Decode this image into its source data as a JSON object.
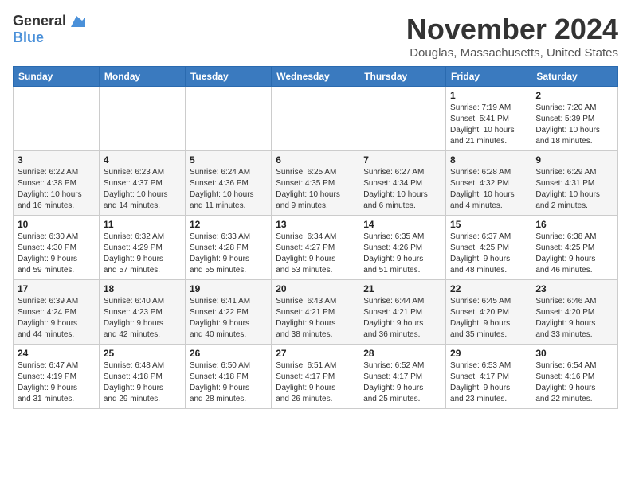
{
  "logo": {
    "line1": "General",
    "line2": "Blue"
  },
  "header": {
    "month": "November 2024",
    "location": "Douglas, Massachusetts, United States"
  },
  "weekdays": [
    "Sunday",
    "Monday",
    "Tuesday",
    "Wednesday",
    "Thursday",
    "Friday",
    "Saturday"
  ],
  "weeks": [
    [
      {
        "day": "",
        "info": ""
      },
      {
        "day": "",
        "info": ""
      },
      {
        "day": "",
        "info": ""
      },
      {
        "day": "",
        "info": ""
      },
      {
        "day": "",
        "info": ""
      },
      {
        "day": "1",
        "info": "Sunrise: 7:19 AM\nSunset: 5:41 PM\nDaylight: 10 hours\nand 21 minutes."
      },
      {
        "day": "2",
        "info": "Sunrise: 7:20 AM\nSunset: 5:39 PM\nDaylight: 10 hours\nand 18 minutes."
      }
    ],
    [
      {
        "day": "3",
        "info": "Sunrise: 6:22 AM\nSunset: 4:38 PM\nDaylight: 10 hours\nand 16 minutes."
      },
      {
        "day": "4",
        "info": "Sunrise: 6:23 AM\nSunset: 4:37 PM\nDaylight: 10 hours\nand 14 minutes."
      },
      {
        "day": "5",
        "info": "Sunrise: 6:24 AM\nSunset: 4:36 PM\nDaylight: 10 hours\nand 11 minutes."
      },
      {
        "day": "6",
        "info": "Sunrise: 6:25 AM\nSunset: 4:35 PM\nDaylight: 10 hours\nand 9 minutes."
      },
      {
        "day": "7",
        "info": "Sunrise: 6:27 AM\nSunset: 4:34 PM\nDaylight: 10 hours\nand 6 minutes."
      },
      {
        "day": "8",
        "info": "Sunrise: 6:28 AM\nSunset: 4:32 PM\nDaylight: 10 hours\nand 4 minutes."
      },
      {
        "day": "9",
        "info": "Sunrise: 6:29 AM\nSunset: 4:31 PM\nDaylight: 10 hours\nand 2 minutes."
      }
    ],
    [
      {
        "day": "10",
        "info": "Sunrise: 6:30 AM\nSunset: 4:30 PM\nDaylight: 9 hours\nand 59 minutes."
      },
      {
        "day": "11",
        "info": "Sunrise: 6:32 AM\nSunset: 4:29 PM\nDaylight: 9 hours\nand 57 minutes."
      },
      {
        "day": "12",
        "info": "Sunrise: 6:33 AM\nSunset: 4:28 PM\nDaylight: 9 hours\nand 55 minutes."
      },
      {
        "day": "13",
        "info": "Sunrise: 6:34 AM\nSunset: 4:27 PM\nDaylight: 9 hours\nand 53 minutes."
      },
      {
        "day": "14",
        "info": "Sunrise: 6:35 AM\nSunset: 4:26 PM\nDaylight: 9 hours\nand 51 minutes."
      },
      {
        "day": "15",
        "info": "Sunrise: 6:37 AM\nSunset: 4:25 PM\nDaylight: 9 hours\nand 48 minutes."
      },
      {
        "day": "16",
        "info": "Sunrise: 6:38 AM\nSunset: 4:25 PM\nDaylight: 9 hours\nand 46 minutes."
      }
    ],
    [
      {
        "day": "17",
        "info": "Sunrise: 6:39 AM\nSunset: 4:24 PM\nDaylight: 9 hours\nand 44 minutes."
      },
      {
        "day": "18",
        "info": "Sunrise: 6:40 AM\nSunset: 4:23 PM\nDaylight: 9 hours\nand 42 minutes."
      },
      {
        "day": "19",
        "info": "Sunrise: 6:41 AM\nSunset: 4:22 PM\nDaylight: 9 hours\nand 40 minutes."
      },
      {
        "day": "20",
        "info": "Sunrise: 6:43 AM\nSunset: 4:21 PM\nDaylight: 9 hours\nand 38 minutes."
      },
      {
        "day": "21",
        "info": "Sunrise: 6:44 AM\nSunset: 4:21 PM\nDaylight: 9 hours\nand 36 minutes."
      },
      {
        "day": "22",
        "info": "Sunrise: 6:45 AM\nSunset: 4:20 PM\nDaylight: 9 hours\nand 35 minutes."
      },
      {
        "day": "23",
        "info": "Sunrise: 6:46 AM\nSunset: 4:20 PM\nDaylight: 9 hours\nand 33 minutes."
      }
    ],
    [
      {
        "day": "24",
        "info": "Sunrise: 6:47 AM\nSunset: 4:19 PM\nDaylight: 9 hours\nand 31 minutes."
      },
      {
        "day": "25",
        "info": "Sunrise: 6:48 AM\nSunset: 4:18 PM\nDaylight: 9 hours\nand 29 minutes."
      },
      {
        "day": "26",
        "info": "Sunrise: 6:50 AM\nSunset: 4:18 PM\nDaylight: 9 hours\nand 28 minutes."
      },
      {
        "day": "27",
        "info": "Sunrise: 6:51 AM\nSunset: 4:17 PM\nDaylight: 9 hours\nand 26 minutes."
      },
      {
        "day": "28",
        "info": "Sunrise: 6:52 AM\nSunset: 4:17 PM\nDaylight: 9 hours\nand 25 minutes."
      },
      {
        "day": "29",
        "info": "Sunrise: 6:53 AM\nSunset: 4:17 PM\nDaylight: 9 hours\nand 23 minutes."
      },
      {
        "day": "30",
        "info": "Sunrise: 6:54 AM\nSunset: 4:16 PM\nDaylight: 9 hours\nand 22 minutes."
      }
    ]
  ]
}
